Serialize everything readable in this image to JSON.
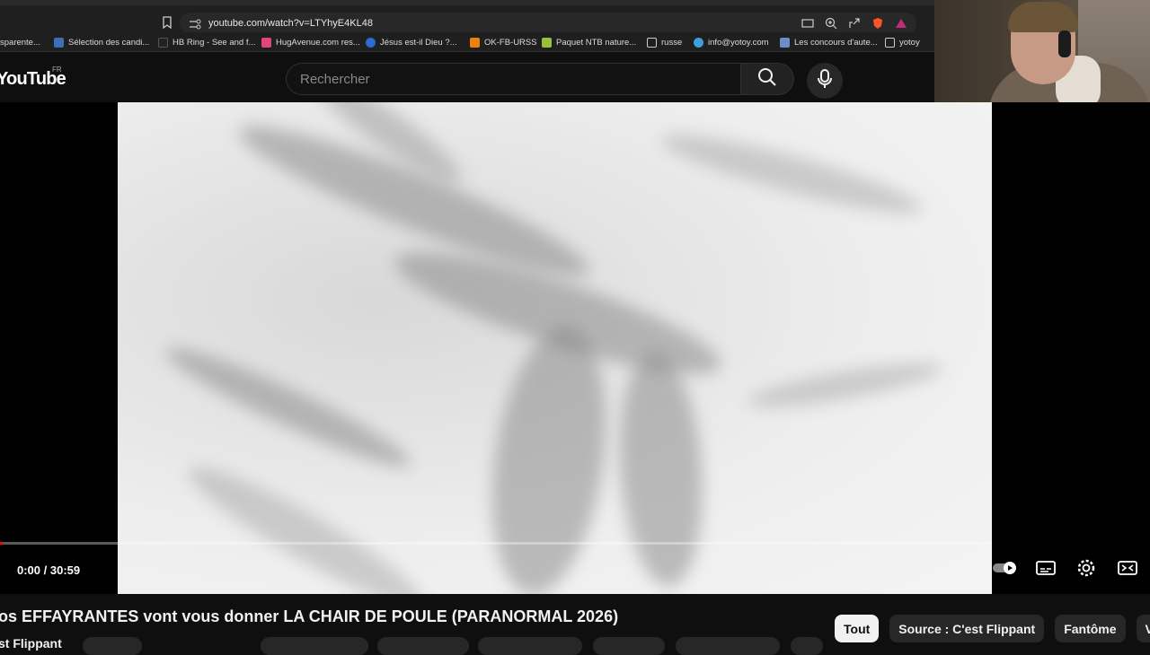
{
  "browser": {
    "url": "youtube.com/watch?v=LTYhyE4KL48",
    "bookmarks": [
      {
        "label": "sparente...",
        "color": "#4a4a4a"
      },
      {
        "label": "Sélection des candi...",
        "color": "#3d6fb6"
      },
      {
        "label": "HB Ring - See and f...",
        "color": "#222222"
      },
      {
        "label": "HugAvenue.com res...",
        "color": "#e0457b"
      },
      {
        "label": "Jésus est-il Dieu ?...",
        "color": "#2c6bd1"
      },
      {
        "label": "OK-FB-URSS",
        "color": "#ee8208"
      },
      {
        "label": "Paquet NTB nature...",
        "color": "#9bbf3c"
      },
      {
        "label": "russe",
        "color": "folder"
      },
      {
        "label": "info@yotoy.com",
        "color": "#3da0d9"
      },
      {
        "label": "Les concours d'aute...",
        "color": "#6b8fc4"
      },
      {
        "label": "yotoy",
        "color": "folder"
      }
    ]
  },
  "header": {
    "logo": "YouTube",
    "country": "FR",
    "search_placeholder": "Rechercher"
  },
  "player": {
    "time": "0:00 / 30:59",
    "progress": 0.003
  },
  "video": {
    "title": "os EFFAYRANTES vont vous donner LA CHAIR DE POULE (PARANORMAL 2026)",
    "channel": "st Flippant"
  },
  "chips": [
    "Tout",
    "Source : C'est Flippant",
    "Fantôme",
    "Vid"
  ],
  "colors": {
    "accent": "#ff0000",
    "background": "#0f0f0f"
  }
}
